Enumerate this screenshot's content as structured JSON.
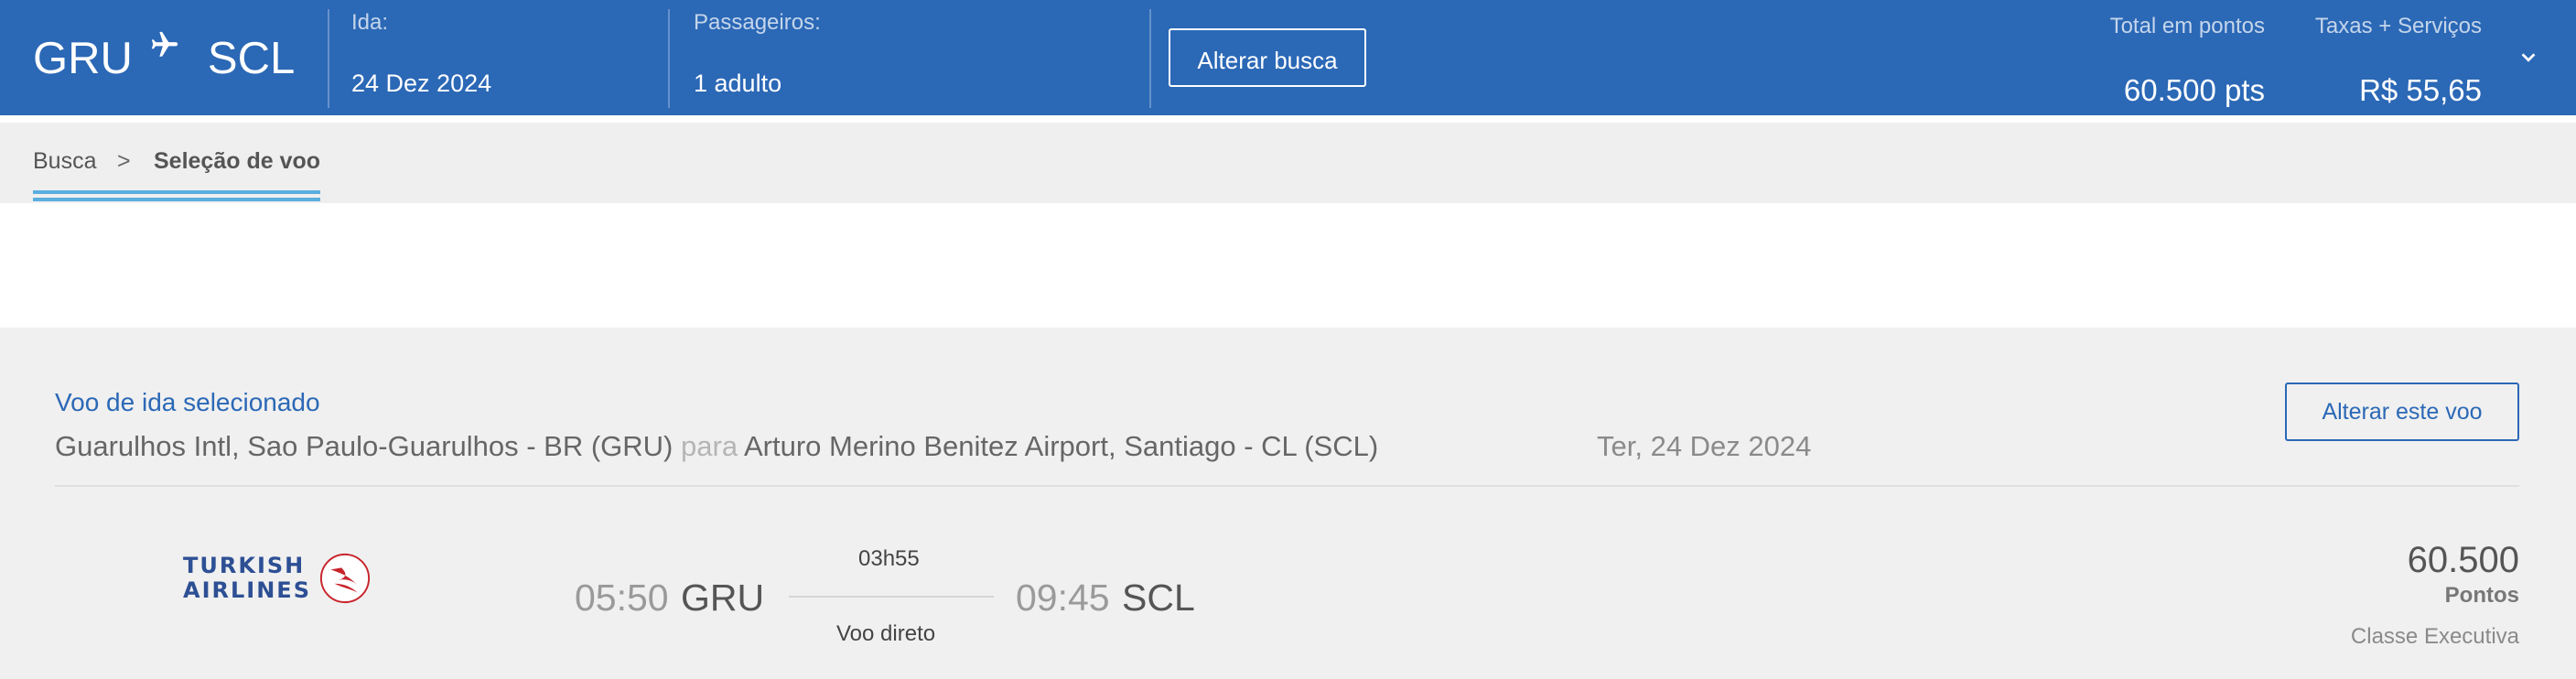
{
  "header": {
    "origin": "GRU",
    "destination": "SCL",
    "plane_icon": "plane-icon",
    "departure_label": "Ida:",
    "departure_value": "24 Dez 2024",
    "passengers_label": "Passageiros:",
    "passengers_value": "1 adulto",
    "change_search_label": "Alterar busca",
    "total_points_label": "Total em pontos",
    "total_points_value": "60.500 pts",
    "fees_label": "Taxas + Serviços",
    "fees_value": "R$ 55,65",
    "expand_icon": "chevron-down-icon",
    "bg_color": "#2b68b6"
  },
  "breadcrumb": {
    "items": [
      "Busca",
      "Seleção de voo"
    ],
    "separator": ">",
    "accent_color": "#5aaee0"
  },
  "selected_flight": {
    "title": "Voo de ida selecionado",
    "origin_airport": "Guarulhos Intl, Sao Paulo-Guarulhos - BR (GRU)",
    "connector": "para",
    "destination_airport": "Arturo Merino Benitez Airport, Santiago - CL (SCL)",
    "date": "Ter, 24 Dez 2024",
    "change_flight_label": "Alterar este voo",
    "airline": {
      "name_line1": "TURKISH",
      "name_line2": "AIRLINES",
      "logo_icon": "turkish-airlines-logo"
    },
    "departure_time": "05:50",
    "departure_code": "GRU",
    "arrival_time": "09:45",
    "arrival_code": "SCL",
    "duration": "03h55",
    "stops": "Voo direto",
    "price": "60.500",
    "price_unit": "Pontos",
    "cabin": "Classe Executiva"
  }
}
